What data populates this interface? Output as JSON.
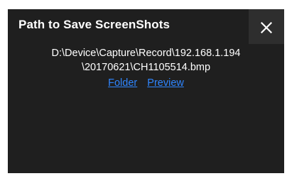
{
  "dialog": {
    "title": "Path to Save ScreenShots",
    "close_icon": "close-icon",
    "path_line1": "D:\\Device\\Capture\\Record\\192.168.1.194",
    "path_line2": "\\20170621\\CH1105514.bmp",
    "folder_link": "Folder",
    "preview_link": "Preview"
  },
  "colors": {
    "background": "#1f1f1f",
    "close_button": "#2e2e2e",
    "text": "#ffffff",
    "link": "#2f86ff"
  }
}
